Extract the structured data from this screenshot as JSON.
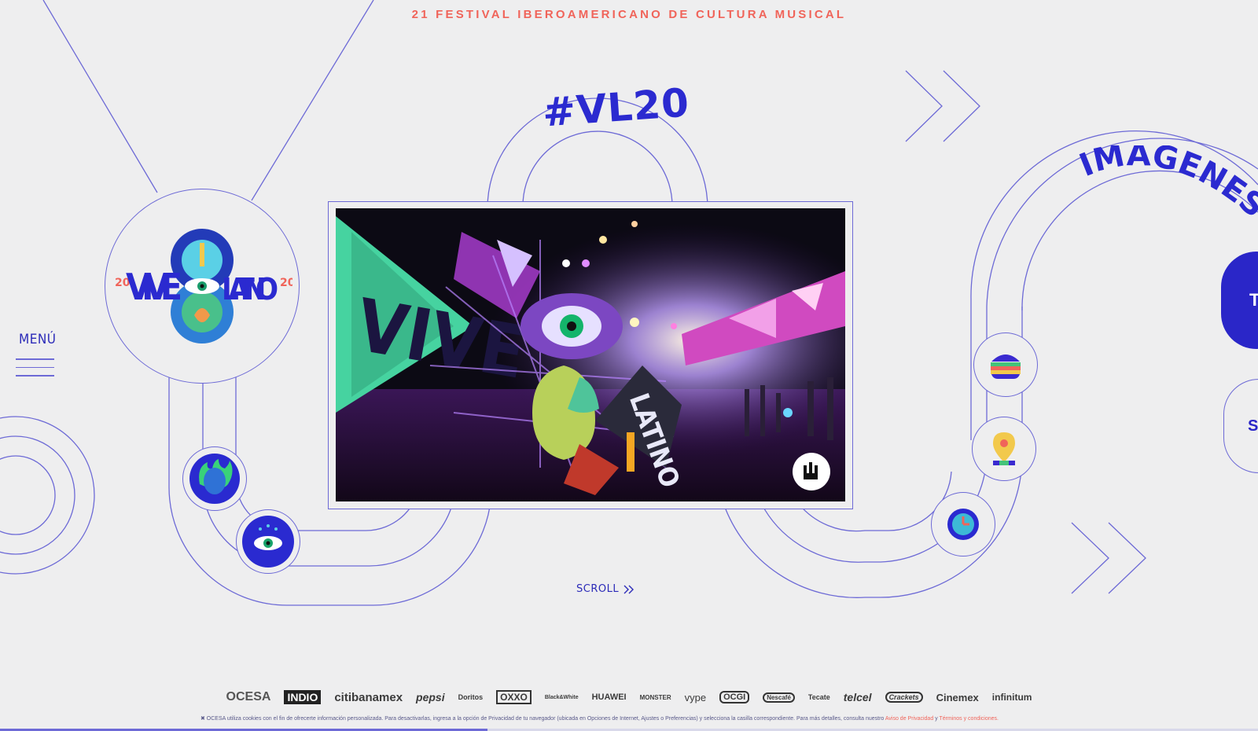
{
  "header": {
    "festival_title": "21 FESTIVAL IBEROAMERICANO DE CULTURA MUSICAL"
  },
  "hero": {
    "hashtag": "#VL20"
  },
  "logo": {
    "word_left": "VIVE",
    "word_right": "LATINO",
    "year_left": "20",
    "year_right": "20"
  },
  "nav": {
    "menu_label": "MENÚ",
    "scroll_label": "SCROLL"
  },
  "section": {
    "heading": "IMÁGENES",
    "tab_primary": "T",
    "tab_secondary": "SA"
  },
  "photo": {
    "sign_text": "VIVE",
    "booth_text": "LATINO"
  },
  "icons": [
    "flame-face-icon",
    "eye-icon",
    "burger-icon",
    "location-pin-icon",
    "clock-icon",
    "rock-hand-icon"
  ],
  "sponsors": [
    "OCESA",
    "INDIO",
    "citibanamex",
    "pepsi",
    "Doritos",
    "OXXO",
    "Black&White",
    "HUAWEI",
    "MONSTER",
    "vype",
    "OCGI",
    "Nescafé",
    "Tecate",
    "telcel",
    "Crackets",
    "Cinemex",
    "infinitum"
  ],
  "cookie": {
    "text": "✖ OCESA utiliza cookies con el fin de ofrecerte información personalizada. Para desactivarlas, ingresa a la opción de Privacidad de tu navegador (ubicada en Opciones de Internet, Ajustes o Preferencias) y selecciona la casilla correspondiente. Para más detalles, consulta nuestro",
    "privacy_link": "Aviso de Privacidad",
    "conj": "y",
    "terms_link": "Términos y condiciones."
  },
  "colors": {
    "accent": "#2b2ad0",
    "line": "#6d6ad6",
    "title": "#f0645a",
    "background": "#eeeeef"
  }
}
